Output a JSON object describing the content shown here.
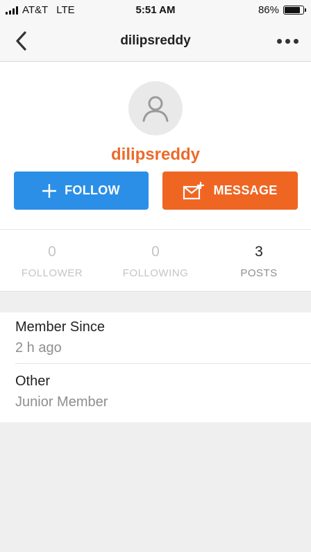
{
  "status_bar": {
    "carrier": "AT&T",
    "network": "LTE",
    "time": "5:51 AM",
    "battery_percent": "86%",
    "battery_level": 0.86
  },
  "nav": {
    "title": "dilipsreddy",
    "back_icon": "chevron-left-icon",
    "more_icon": "more-horizontal-icon"
  },
  "profile": {
    "avatar_icon": "user-icon",
    "username": "dilipsreddy",
    "follow_label": "FOLLOW",
    "message_label": "MESSAGE",
    "colors": {
      "username": "#ec6a2c",
      "follow_button": "#2b8fe8",
      "message_button": "#ef6623"
    }
  },
  "stats": {
    "followers": {
      "value": "0",
      "label": "FOLLOWER"
    },
    "following": {
      "value": "0",
      "label": "FOLLOWING"
    },
    "posts": {
      "value": "3",
      "label": "POSTS"
    }
  },
  "details": {
    "member_since": {
      "title": "Member Since",
      "value": "2 h ago"
    },
    "other": {
      "title": "Other",
      "value": "Junior Member"
    }
  }
}
